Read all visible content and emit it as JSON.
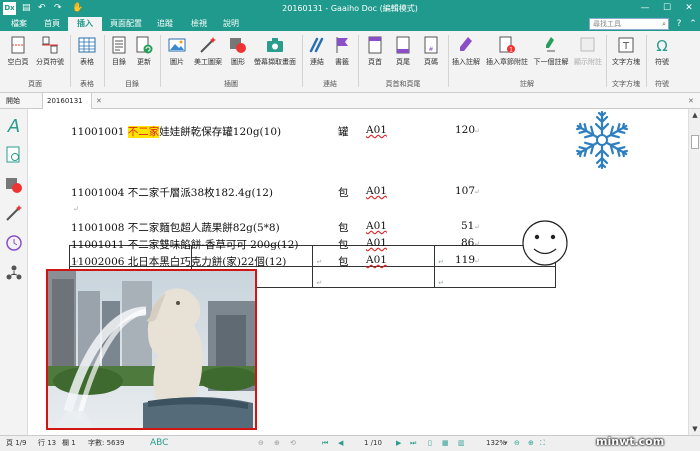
{
  "app": {
    "logo_text": "Dx",
    "title": "20160131 - Gaaiho Doc (編輯模式)",
    "accent": "#1f9a8c"
  },
  "quick_access": [
    "save-icon",
    "undo-icon",
    "redo-icon",
    "hand-icon"
  ],
  "menu": {
    "tabs": [
      "檔案",
      "首頁",
      "插入",
      "頁面配置",
      "追蹤",
      "檢視",
      "說明"
    ],
    "active": "插入",
    "search_placeholder": "尋找工具"
  },
  "ribbon": {
    "buttons": {
      "blank_page": "空白頁",
      "page_break": "分頁符號",
      "table": "表格",
      "toc": "目錄",
      "update": "更新",
      "picture": "圖片",
      "clipart": "美工圖案",
      "shape": "圖形",
      "screenshot": "螢幕擷取畫面",
      "link": "連結",
      "bookmark": "書籤",
      "header": "頁首",
      "footer": "頁尾",
      "page_number": "頁碼",
      "insert_note": "插入註解",
      "insert_chapter_note": "插入章節附註",
      "next_note": "下一個註解",
      "show_note": "顯示附註",
      "textbox": "文字方塊",
      "symbol": "符號"
    },
    "groups": {
      "pages": "頁面",
      "tables": "表格",
      "toc": "目錄",
      "illustrations": "插圖",
      "links": "連結",
      "header_footer": "頁首和頁尾",
      "notes": "註解",
      "text": "文字方塊",
      "symbols": "符號"
    }
  },
  "doc_tabs": [
    "開始",
    "20160131 *"
  ],
  "document": {
    "row1": {
      "code": "11001001",
      "highlight": "不二家",
      "name": "娃娃餅乾保存罐120g(10)",
      "unit": "罐",
      "loc": "A01",
      "qty": "120"
    },
    "row2": {
      "code": "11001004",
      "name": "不二家千層派38枚182.4g(12)",
      "unit": "包",
      "loc": "A01",
      "qty": "107"
    },
    "row3": {
      "code": "11001008",
      "name": "不二家麵包超人蔬果餅82g(5*8)",
      "unit": "包",
      "loc": "A01",
      "qty": "51"
    },
    "row4": {
      "code": "11001011",
      "name": "不二家雙味餡餅-香草可可 200g(12)",
      "unit": "包",
      "loc": "A01",
      "qty": "86"
    },
    "row5": {
      "code": "11002006",
      "name": "北日本黑白巧克力餅(家)22個(12)",
      "unit": "包",
      "loc": "A01",
      "qty": "119"
    },
    "return_mark": "↵"
  },
  "status": {
    "page": "頁 1/9",
    "line": "行 13",
    "column": "欄 1",
    "words": "字數: 5639",
    "page_nav": "1 /10",
    "zoom": "132%",
    "watermark": "minwt.com"
  }
}
